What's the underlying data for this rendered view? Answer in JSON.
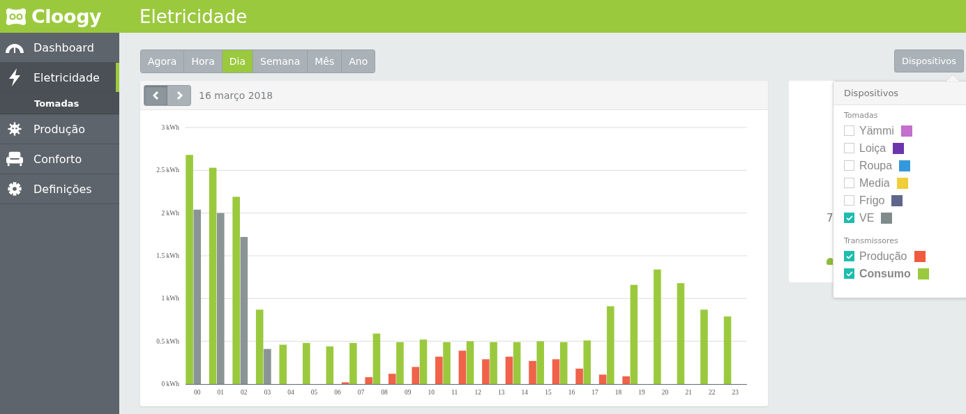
{
  "header": {
    "logo": "Cloogy",
    "title": "Eletricidade"
  },
  "sidebar": {
    "items": [
      {
        "label": "Dashboard",
        "selected": false
      },
      {
        "label": "Eletricidade",
        "selected": true,
        "children": [
          {
            "label": "Tomadas"
          }
        ]
      },
      {
        "label": "Produção",
        "selected": false
      },
      {
        "label": "Conforto",
        "selected": false
      },
      {
        "label": "Definições",
        "selected": false
      }
    ]
  },
  "period_tabs": [
    {
      "label": "Agora",
      "selected": false
    },
    {
      "label": "Hora",
      "selected": false
    },
    {
      "label": "Dia",
      "selected": true
    },
    {
      "label": "Semana",
      "selected": false
    },
    {
      "label": "Mês",
      "selected": false
    },
    {
      "label": "Ano",
      "selected": false
    }
  ],
  "chart_card": {
    "date": "16 março 2018",
    "chart_data": {
      "type": "bar",
      "categories": [
        "00",
        "01",
        "02",
        "03",
        "04",
        "05",
        "06",
        "07",
        "08",
        "09",
        "10",
        "11",
        "12",
        "13",
        "14",
        "15",
        "16",
        "17",
        "18",
        "19",
        "20",
        "21",
        "22",
        "23"
      ],
      "series": [
        {
          "color": "#9bc93e",
          "values": [
            2.68,
            2.53,
            2.19,
            0.87,
            0.46,
            0.48,
            0.44,
            0.48,
            0.59,
            0.49,
            0.52,
            0.49,
            0.5,
            0.49,
            0.49,
            0.5,
            0.49,
            0.51,
            0.91,
            1.16,
            1.34,
            1.18,
            0.87,
            0.79
          ]
        },
        {
          "color": "#8a9494",
          "values": [
            2.04,
            2.0,
            1.72,
            0.41,
            null,
            null,
            null,
            null,
            null,
            null,
            null,
            null,
            null,
            null,
            null,
            null,
            null,
            null,
            null,
            null,
            null,
            null,
            null,
            null
          ]
        },
        {
          "color": "#f0624a",
          "values": [
            null,
            null,
            null,
            null,
            null,
            null,
            0.02,
            0.08,
            0.12,
            0.2,
            0.32,
            0.39,
            0.29,
            0.32,
            0.27,
            0.29,
            0.18,
            0.11,
            0.09,
            null,
            null,
            null,
            null,
            null
          ]
        }
      ],
      "ylim": [
        0,
        3
      ],
      "grid": true,
      "yticks": [
        {
          "value": 0,
          "label": "0 kWh"
        },
        {
          "value": 0.5,
          "label": "0.5 kWh"
        },
        {
          "value": 1,
          "label": "1 kWh"
        },
        {
          "value": 1.5,
          "label": "1.5 kWh"
        },
        {
          "value": 2,
          "label": "2 kWh"
        },
        {
          "value": 2.5,
          "label": "2.5 kWh"
        },
        {
          "value": 3,
          "label": "3 kWh"
        }
      ]
    }
  },
  "side_card": {
    "value": "7"
  },
  "devices_button": "Dispositivos",
  "devices_menu": {
    "title": "Dispositivos",
    "groups": [
      {
        "heading": "Tomadas",
        "items": [
          {
            "label": "Yämmi",
            "checked": false,
            "bold": false,
            "color": "#c46ecd"
          },
          {
            "label": "Loiça",
            "checked": false,
            "bold": false,
            "color": "#6d35ad"
          },
          {
            "label": "Roupa",
            "checked": false,
            "bold": false,
            "color": "#3498db"
          },
          {
            "label": "Media",
            "checked": false,
            "bold": false,
            "color": "#f0ce3a"
          },
          {
            "label": "Frigo",
            "checked": false,
            "bold": false,
            "color": "#5e668b"
          },
          {
            "label": "VE",
            "checked": true,
            "bold": false,
            "color": "#808b8b"
          }
        ]
      },
      {
        "heading": "Transmissores",
        "items": [
          {
            "label": "Produção",
            "checked": true,
            "bold": false,
            "color": "#f05a3f"
          },
          {
            "label": "Consumo",
            "checked": true,
            "bold": true,
            "color": "#9bc93e"
          }
        ]
      }
    ]
  }
}
